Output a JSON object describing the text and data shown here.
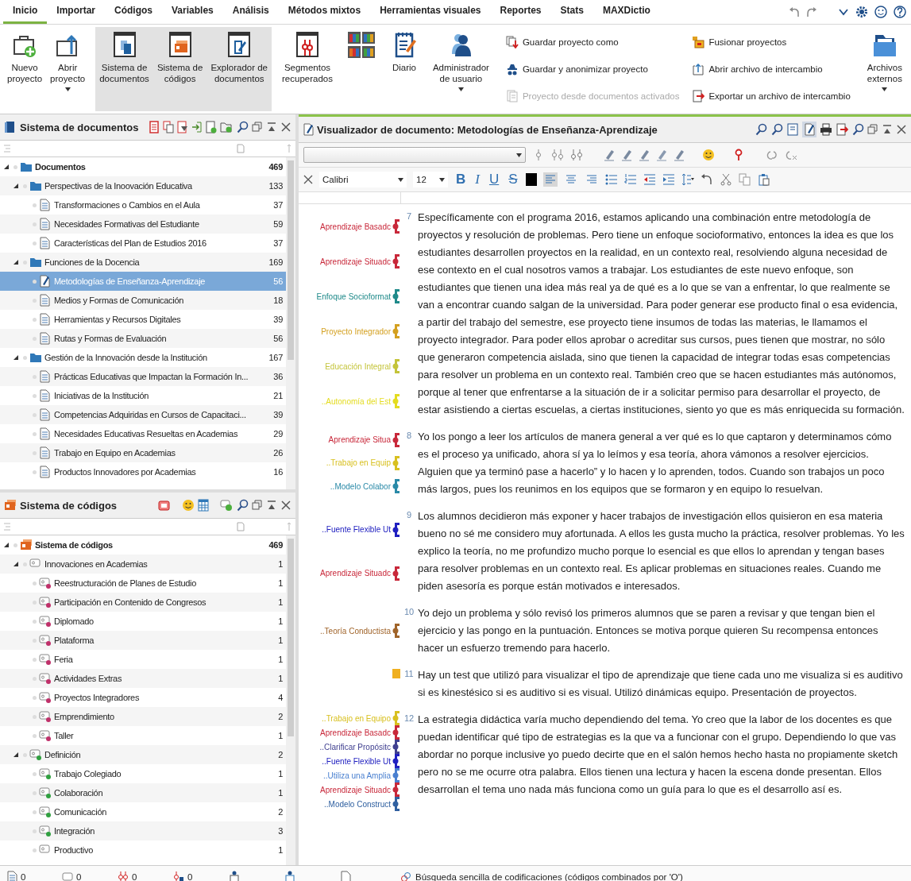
{
  "menu_tabs": [
    {
      "label": "Inicio",
      "selected": true
    },
    {
      "label": "Importar",
      "selected": false
    },
    {
      "label": "Códigos",
      "selected": false
    },
    {
      "label": "Variables",
      "selected": false
    },
    {
      "label": "Análisis",
      "selected": false
    },
    {
      "label": "Métodos mixtos",
      "selected": false
    },
    {
      "label": "Herramientas visuales",
      "selected": false
    },
    {
      "label": "Reportes",
      "selected": false
    },
    {
      "label": "Stats",
      "selected": false
    },
    {
      "label": "MAXDictio",
      "selected": false
    }
  ],
  "ribbon": {
    "large_buttons": [
      {
        "lines": [
          "Nuevo",
          "proyecto"
        ],
        "dropdown": false,
        "selected": false
      },
      {
        "lines": [
          "Abrir",
          "proyecto"
        ],
        "dropdown": true,
        "selected": false
      },
      {
        "lines": [
          "Sistema de",
          "documentos"
        ],
        "dropdown": false,
        "selected": true
      },
      {
        "lines": [
          "Sistema de",
          "códigos"
        ],
        "dropdown": false,
        "selected": true
      },
      {
        "lines": [
          "Explorador de",
          "documentos"
        ],
        "dropdown": false,
        "selected": true
      },
      {
        "lines": [
          "Segmentos",
          "recuperados"
        ],
        "dropdown": false,
        "selected": false
      },
      {
        "dropdown": false,
        "selected": false
      },
      {
        "lines": [
          "Diario"
        ],
        "dropdown": false,
        "selected": false
      },
      {
        "lines": [
          "Administrador",
          "de usuario"
        ],
        "dropdown": true,
        "selected": false
      }
    ],
    "small_columns": [
      {
        "buttons": [
          {
            "label": "Guardar proyecto como",
            "disabled": false
          },
          {
            "label": "Guardar y anonimizar proyecto",
            "disabled": false
          },
          {
            "label": "Proyecto desde documentos activados",
            "disabled": true
          }
        ]
      },
      {
        "buttons": [
          {
            "label": "Fusionar proyectos",
            "disabled": false
          },
          {
            "label": "Abrir archivo de intercambio",
            "disabled": false
          },
          {
            "label": "Exportar un archivo de intercambio",
            "disabled": false
          }
        ]
      }
    ],
    "external_button": {
      "lines": [
        "Archivos",
        "externos"
      ],
      "dropdown": true,
      "selected": false
    }
  },
  "document_system": {
    "title": "Sistema de documentos",
    "tree": [
      {
        "name": "Documentos",
        "count": "469",
        "expanded": true,
        "selected": false,
        "children": [
          {
            "name": "Perspectivas de la Inoovación Educativa",
            "count": "133",
            "expanded": true,
            "selected": false,
            "children": [
              {
                "name": "Transformaciones o Cambios en el Aula",
                "count": "37",
                "selected": false
              },
              {
                "name": "Necesidades Formativas del Estudiante",
                "count": "59",
                "selected": false
              },
              {
                "name": "Características del Plan de Estudios 2016",
                "count": "37",
                "selected": false
              }
            ]
          },
          {
            "name": "Funciones de la Docencia",
            "count": "169",
            "expanded": true,
            "selected": false,
            "children": [
              {
                "name": "Metodologías de Enseñanza-Aprendizaje",
                "count": "56",
                "selected": true
              },
              {
                "name": "Medios y Formas de Comunicación",
                "count": "18",
                "selected": false
              },
              {
                "name": "Herramientas y Recursos Digitales",
                "count": "39",
                "selected": false
              },
              {
                "name": "Rutas y Formas de Evaluación",
                "count": "56",
                "selected": false
              }
            ]
          },
          {
            "name": "Gestión de la Innovación desde la Institución",
            "count": "167",
            "expanded": true,
            "selected": false,
            "children": [
              {
                "name": "Prácticas Educativas que Impactan la Formación In...",
                "count": "36",
                "selected": false
              },
              {
                "name": "Iniciativas de la Institución",
                "count": "21",
                "selected": false
              },
              {
                "name": "Competencias Adquiridas en Cursos de Capacitaci...",
                "count": "39",
                "selected": false
              },
              {
                "name": "Necesidades Educativas Resueltas en Academias",
                "count": "29",
                "selected": false
              },
              {
                "name": "Trabajo en Equipo en Academias",
                "count": "26",
                "selected": false
              },
              {
                "name": "Productos Innovadores por Academias",
                "count": "16",
                "selected": false
              }
            ]
          }
        ]
      }
    ]
  },
  "code_system": {
    "title": "Sistema de códigos",
    "tree": [
      {
        "name": "Sistema de códigos",
        "count": "469",
        "expanded": true,
        "selected": false,
        "children": [
          {
            "name": "Innovaciones en Academias",
            "count": "1",
            "expanded": true,
            "selected": false,
            "children": [
              {
                "name": "Reestructuración de Planes de Estudio",
                "count": "1",
                "selected": false,
                "color": "#c0306a"
              },
              {
                "name": "Participación en Contenido de Congresos",
                "count": "1",
                "selected": false,
                "color": "#c0306a"
              },
              {
                "name": "Diplomado",
                "count": "1",
                "selected": false,
                "color": "#c0306a"
              },
              {
                "name": "Plataforma",
                "count": "1",
                "selected": false,
                "color": "#c0306a"
              },
              {
                "name": "Feria",
                "count": "1",
                "selected": false,
                "color": "#c0306a"
              },
              {
                "name": "Actividades Extras",
                "count": "1",
                "selected": false,
                "color": "#c0306a"
              },
              {
                "name": "Proyectos Integradores",
                "count": "4",
                "selected": false,
                "color": "#c0306a"
              },
              {
                "name": "Emprendimiento",
                "count": "2",
                "selected": false,
                "color": "#c0306a"
              },
              {
                "name": "Taller",
                "count": "1",
                "selected": false,
                "color": "#c0306a"
              }
            ]
          },
          {
            "name": "Definición",
            "count": "2",
            "expanded": true,
            "selected": false,
            "color": "#30a040",
            "children": [
              {
                "name": "Trabajo Colegiado",
                "count": "1",
                "selected": false,
                "color": "#30a040"
              },
              {
                "name": "Colaboración",
                "count": "1",
                "selected": false,
                "color": "#30a040"
              },
              {
                "name": "Comunicación",
                "count": "2",
                "selected": false,
                "color": "#30a040"
              },
              {
                "name": "Integración",
                "count": "3",
                "selected": false,
                "color": "#30a040"
              },
              {
                "name": "Productivo",
                "count": "1",
                "selected": false
              }
            ]
          }
        ]
      }
    ]
  },
  "viewer": {
    "title": "Visualizador de documento: Metodologías de Enseñanza-Aprendizaje",
    "edit_mode": true,
    "font": "Calibri",
    "size": "12",
    "format_buttons": [
      {
        "label": "B",
        "kind": "bold"
      },
      {
        "label": "I",
        "kind": "italic"
      },
      {
        "label": "U",
        "kind": "underline"
      },
      {
        "label": "S",
        "kind": "strike"
      }
    ],
    "align": [
      {
        "selected": true
      },
      {
        "selected": false
      },
      {
        "selected": false
      }
    ],
    "paragraphs": [
      {
        "number": "7",
        "memo": false,
        "text": "Específicamente con el programa 2016, estamos aplicando una combinación entre metodología de proyectos y resolución de problemas. Pero tiene un enfoque socioformativo, entonces la idea es que los estudiantes desarrollen proyectos en la realidad, en un contexto real, resolviendo alguna necesidad de ese contexto en el cual nosotros vamos a trabajar. Los estudiantes de este nuevo enfoque, son estudiantes que tienen una idea más real ya de qué es a lo que se van a enfrentar, lo que realmente se van a encontrar cuando salgan de la universidad. Para poder generar ese producto final o esa evidencia, a partir del trabajo del semestre, ese proyecto tiene insumos de todas las materias, le llamamos el proyecto integrador. Para poder ellos aprobar o acreditar sus cursos, pues tienen que mostrar, no sólo que generaron competencia aislada, sino que tienen la capacidad de integrar todas esas competencias para resolver un problema en un contexto real. También creo que se hacen estudiantes más autónomos, porque al tener que enfrentarse a la situación de ir a solicitar permiso para desarrollar el proyecto, de estar asistiendo a ciertas escuelas, a ciertas instituciones, siento yo que es más enriquecida su formación.",
        "codes": [
          {
            "label": "Aprendizaje Basadc",
            "color": "#c8283a"
          },
          {
            "label": "Aprendizaje Situadc",
            "color": "#c8283a"
          },
          {
            "label": "Enfoque Socioformat",
            "color": "#1f8a8a"
          },
          {
            "label": "Proyecto Integrador",
            "color": "#d4a020"
          },
          {
            "label": "Educación Integral",
            "color": "#c4c43a"
          },
          {
            "label": "..Autonomía del Est",
            "color": "#e4dc20"
          }
        ]
      },
      {
        "number": "8",
        "memo": false,
        "text": "Yo los pongo a leer los artículos de manera general a ver qué es lo que captaron y determinamos cómo es el proceso ya unificado, ahora sí ya lo leímos y esa teoría, ahora vámonos a resolver ejercicios. Alguien que ya terminó pase a hacerlo” y lo hacen y lo aprenden, todos. Cuando son trabajos un poco más largos, pues los reunimos en los equipos que se formaron y en equipo lo resuelvan.",
        "codes": [
          {
            "label": "Aprendizaje Situa",
            "color": "#c8283a"
          },
          {
            "label": "..Trabajo en Equip",
            "color": "#d8c020"
          },
          {
            "label": "..Modelo Colabor",
            "color": "#2a8aa8"
          }
        ]
      },
      {
        "number": "9",
        "memo": false,
        "text": "Los alumnos decidieron más exponer y hacer trabajos de investigación ellos quisieron en esa materia bueno no sé me considero muy afortunada. A ellos les gusta mucho la práctica, resolver problemas. Yo les explico la teoría, no me profundizo mucho porque lo esencial es que ellos lo aprendan y tengan bases para resolver problemas en un contexto real. Es aplicar problemas en situaciones reales. Cuando me piden asesoría es porque están motivados e interesados.",
        "codes": [
          {
            "label": "..Fuente Flexible Ut",
            "color": "#2020c0"
          },
          {
            "label": "Aprendizaje Situadc",
            "color": "#c8283a"
          }
        ]
      },
      {
        "number": "10",
        "memo": false,
        "text": "Yo dejo un problema y sólo revisó los primeros alumnos que se paren a revisar y que tengan bien el ejercicio y las pongo en la puntuación. Entonces se motiva porque quieren Su recompensa entonces hacer un esfuerzo tremendo para hacerlo.",
        "codes": [
          {
            "label": "..Teoría Conductista",
            "color": "#a0642a"
          }
        ]
      },
      {
        "number": "11",
        "memo": true,
        "text": "Hay un test que utilizó para visualizar el tipo de aprendizaje que tiene cada uno me visualiza si es auditivo si es kinestésico si es auditivo si es visual. Utilizó dinámicas equipo. Presentación de proyectos."
      },
      {
        "number": "12",
        "memo": false,
        "text": "La estrategia didáctica varía mucho dependiendo del tema. Yo creo que la labor de los docentes es que puedan identificar qué tipo de estrategias es la que va a funcionar con el grupo. Dependiendo lo que vas abordar no porque inclusive yo puedo decirte que en el salón hemos hecho hasta no propiamente sketch pero no se me ocurre otra palabra. Ellos tienen una lectura y hacen la escena donde presentan. Ellos desarrollan el tema uno nada más funciona como un guía para lo que es el desarrollo así es.",
        "codes": [
          {
            "label": "..Trabajo en Equipo",
            "color": "#d8c020"
          },
          {
            "label": "Aprendizaje Basadc",
            "color": "#c8283a"
          },
          {
            "label": "..Clarificar Propósitc",
            "color": "#404090"
          },
          {
            "label": "..Fuente Flexible Ut",
            "color": "#2020c0"
          },
          {
            "label": "..Utiliza una Amplia",
            "color": "#4a80d0"
          },
          {
            "label": "Aprendizaje Situadc",
            "color": "#c8283a"
          },
          {
            "label": "..Modelo Construct",
            "color": "#3060a0"
          }
        ]
      }
    ]
  },
  "status_bar": {
    "counts": [
      "0",
      "0",
      "0",
      "0"
    ],
    "search_label": "Búsqueda sencilla de codificaciones (códigos combinados por 'O')"
  }
}
